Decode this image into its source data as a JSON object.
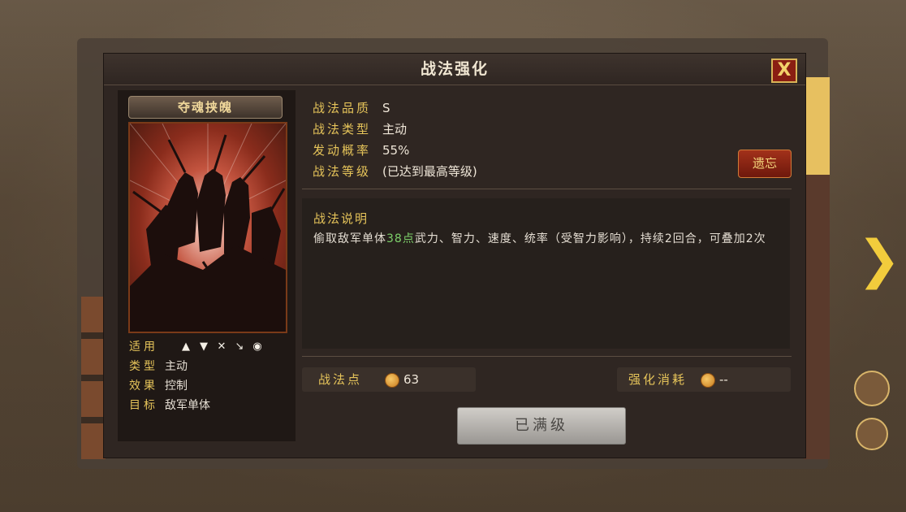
{
  "dialog": {
    "title": "战法强化",
    "close_symbol": "X"
  },
  "card": {
    "name": "夺魂挟魄",
    "attributes": {
      "suitable_label": "适用",
      "suitable_icons": [
        "cavalry-icon",
        "shield-icon",
        "bow-icon",
        "spear-icon",
        "vehicle-icon"
      ],
      "type_label": "类型",
      "type_value": "主动",
      "effect_label": "效果",
      "effect_value": "控制",
      "target_label": "目标",
      "target_value": "敌军单体"
    }
  },
  "info": {
    "quality_label": "战法品质",
    "quality_value": "S",
    "kind_label": "战法类型",
    "kind_value": "主动",
    "rate_label": "发动概率",
    "rate_value": "55%",
    "level_label": "战法等级",
    "level_value": "(已达到最高等级)",
    "reset_label": "遗忘"
  },
  "description": {
    "title": "战法说明",
    "text_before": "偷取敌军单体",
    "highlight": "38点",
    "text_after": "武力、智力、速度、统率（受智力影响），持续2回合，可叠加2次",
    "highlight_color": "#7dd06a"
  },
  "points": {
    "label": "战法点",
    "value": "63"
  },
  "cost": {
    "label": "强化消耗",
    "value": "--"
  },
  "button": {
    "label": "已满级"
  },
  "colors": {
    "gold_label": "#e6c45a",
    "panel": "#2f2622",
    "close_border": "#d8b357"
  }
}
